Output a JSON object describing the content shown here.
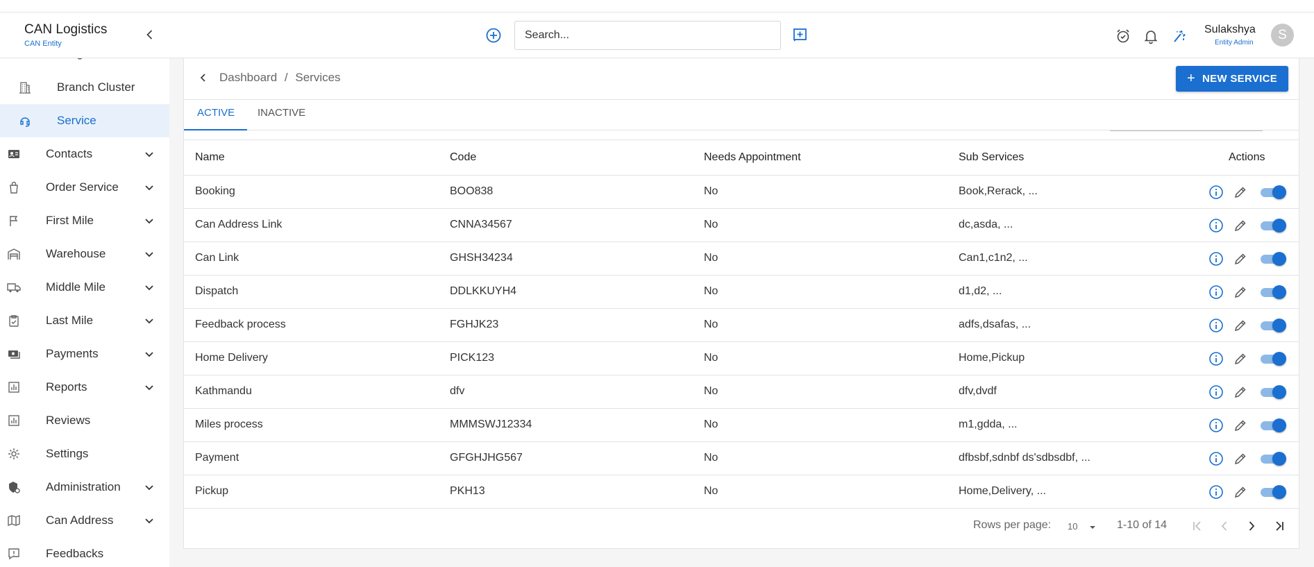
{
  "brand": {
    "title": "CAN Logistics",
    "subtitle": "CAN Entity"
  },
  "search": {
    "placeholder": "Search..."
  },
  "user": {
    "name": "Sulakshya",
    "role": "Entity Admin",
    "initial": "S"
  },
  "sidebar": {
    "items": [
      {
        "label": "Branch Cluster",
        "icon": "building-icon",
        "expandable": false,
        "active": false
      },
      {
        "label": "Service",
        "icon": "headset-icon",
        "expandable": false,
        "active": true
      },
      {
        "label": "Contacts",
        "icon": "contact-card-icon",
        "expandable": true,
        "active": false
      },
      {
        "label": "Order Service",
        "icon": "shopping-bag-icon",
        "expandable": true,
        "active": false
      },
      {
        "label": "First Mile",
        "icon": "flag-icon",
        "expandable": true,
        "active": false
      },
      {
        "label": "Warehouse",
        "icon": "warehouse-icon",
        "expandable": true,
        "active": false
      },
      {
        "label": "Middle Mile",
        "icon": "truck-icon",
        "expandable": true,
        "active": false
      },
      {
        "label": "Last Mile",
        "icon": "clipboard-check-icon",
        "expandable": true,
        "active": false
      },
      {
        "label": "Payments",
        "icon": "payments-icon",
        "expandable": true,
        "active": false
      },
      {
        "label": "Reports",
        "icon": "bar-chart-icon",
        "expandable": true,
        "active": false
      },
      {
        "label": "Reviews",
        "icon": "bar-chart-icon",
        "expandable": false,
        "active": false
      },
      {
        "label": "Settings",
        "icon": "gear-icon",
        "expandable": false,
        "active": false
      },
      {
        "label": "Administration",
        "icon": "admin-shield-icon",
        "expandable": true,
        "active": false
      },
      {
        "label": "Can Address",
        "icon": "map-icon",
        "expandable": true,
        "active": false
      },
      {
        "label": "Feedbacks",
        "icon": "feedback-icon",
        "expandable": false,
        "active": false
      }
    ]
  },
  "breadcrumb": {
    "root": "Dashboard",
    "separator": "/",
    "current": "Services"
  },
  "new_button": {
    "label": "NEW SERVICE"
  },
  "tabs": [
    {
      "label": "ACTIVE",
      "active": true
    },
    {
      "label": "INACTIVE",
      "active": false
    }
  ],
  "table": {
    "headers": [
      "Name",
      "Code",
      "Needs Appointment",
      "Sub Services",
      "Actions"
    ],
    "rows": [
      {
        "name": "Booking",
        "code": "BOO838",
        "appointment": "No",
        "sub": "Book,Rerack, ...",
        "enabled": true
      },
      {
        "name": "Can Address Link",
        "code": "CNNA34567",
        "appointment": "No",
        "sub": "dc,asda, ...",
        "enabled": true
      },
      {
        "name": "Can Link",
        "code": "GHSH34234",
        "appointment": "No",
        "sub": "Can1,c1n2, ...",
        "enabled": true
      },
      {
        "name": "Dispatch",
        "code": "DDLKKUYH4",
        "appointment": "No",
        "sub": "d1,d2, ...",
        "enabled": true
      },
      {
        "name": "Feedback process",
        "code": "FGHJK23",
        "appointment": "No",
        "sub": "adfs,dsafas, ...",
        "enabled": true
      },
      {
        "name": "Home Delivery",
        "code": "PICK123",
        "appointment": "No",
        "sub": "Home,Pickup",
        "enabled": true
      },
      {
        "name": "Kathmandu",
        "code": "dfv",
        "appointment": "No",
        "sub": "dfv,dvdf",
        "enabled": true
      },
      {
        "name": "Miles process",
        "code": "MMMSWJ12334",
        "appointment": "No",
        "sub": "m1,gdda, ...",
        "enabled": true
      },
      {
        "name": "Payment",
        "code": "GFGHJHG567",
        "appointment": "No",
        "sub": "dfbsbf,sdnbf ds'sdbsdbf, ...",
        "enabled": true
      },
      {
        "name": "Pickup",
        "code": "PKH13",
        "appointment": "No",
        "sub": "Home,Delivery, ...",
        "enabled": true
      }
    ]
  },
  "pagination": {
    "rows_label": "Rows per page:",
    "rows_value": "10",
    "range": "1-10 of 14"
  },
  "colors": {
    "accent": "#1a6fd0",
    "active_bg": "#e8f1fb",
    "toggle_track": "#8cb8e8"
  }
}
